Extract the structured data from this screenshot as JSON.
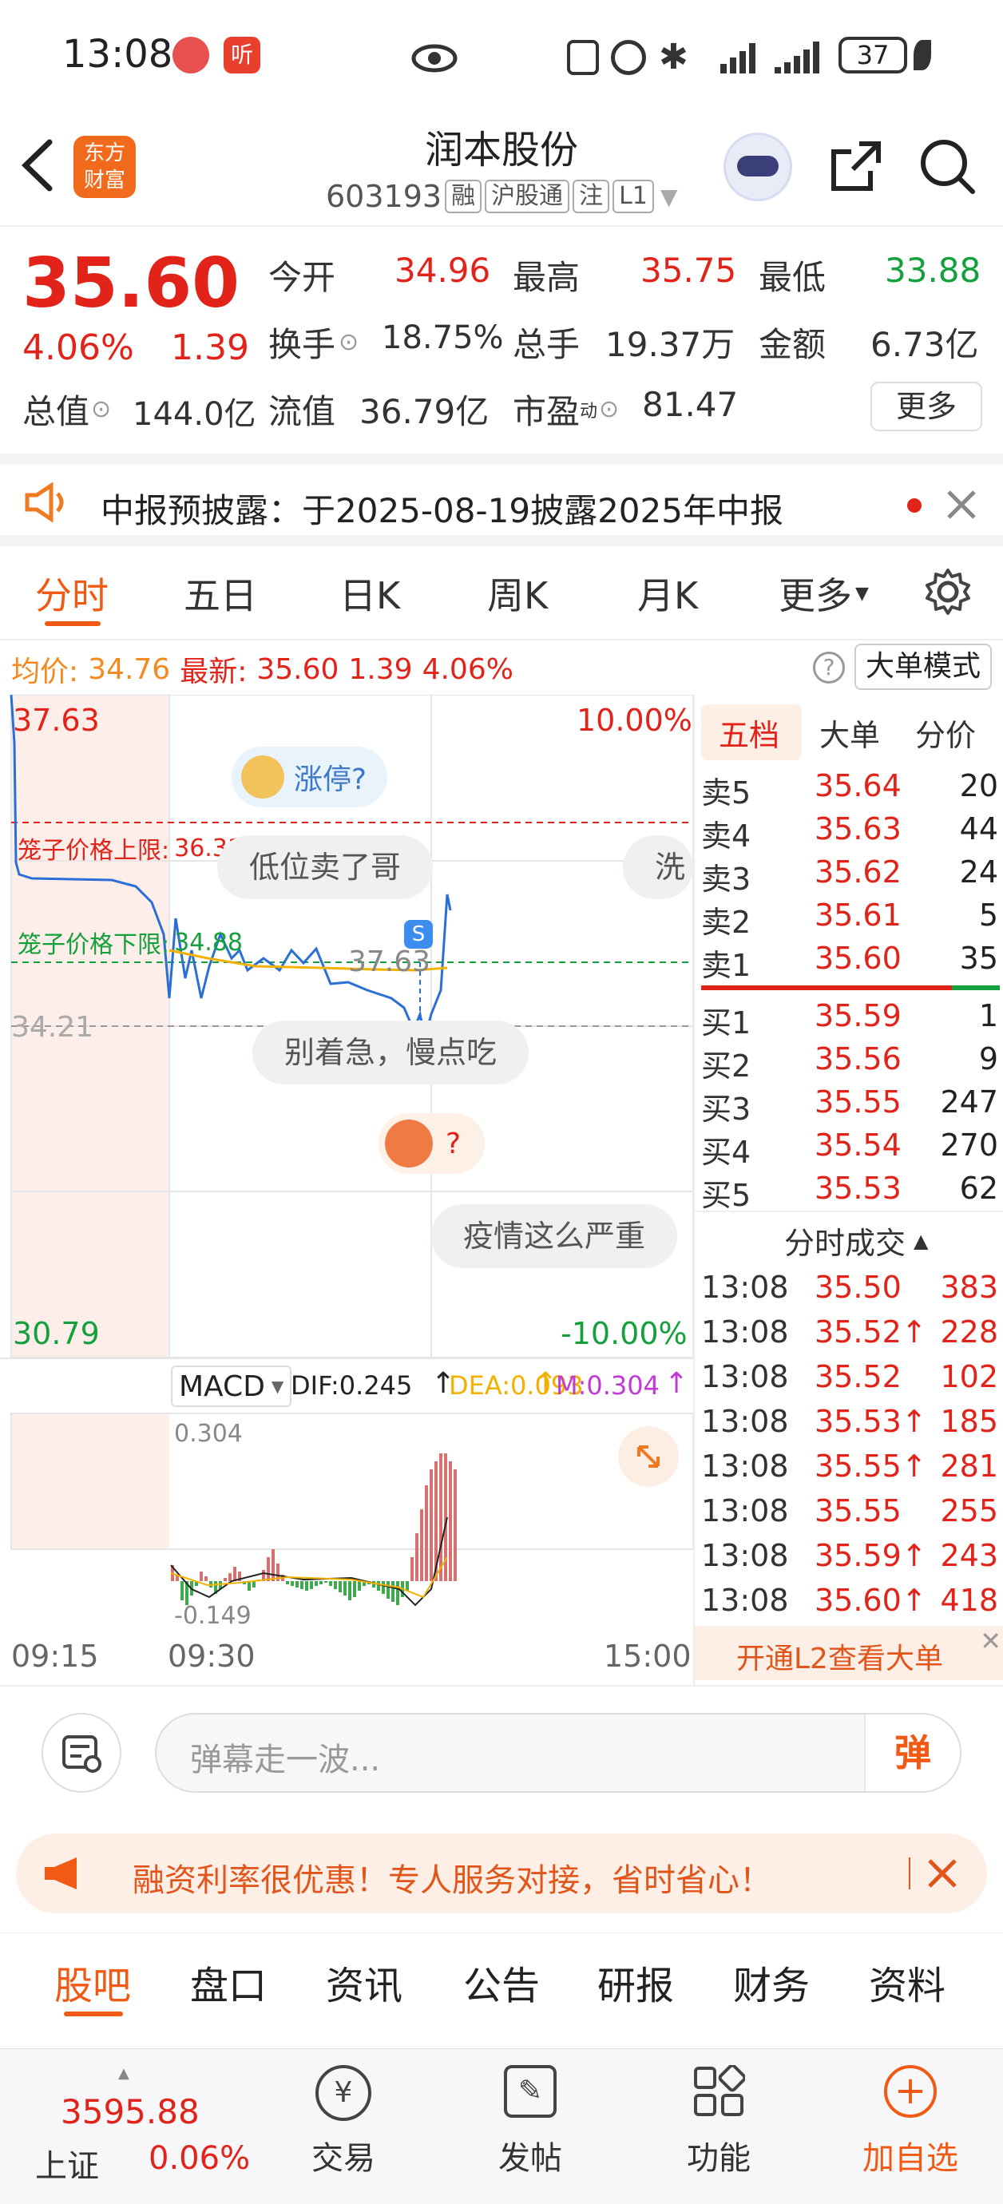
{
  "status_bar": {
    "time": "13:08",
    "battery": "37"
  },
  "header": {
    "title": "润本股份",
    "code": "603193",
    "tags": [
      "融",
      "沪股通",
      "注",
      "L1"
    ],
    "logo_text": [
      "东方",
      "财富"
    ]
  },
  "quote": {
    "price": "35.60",
    "change_pct": "4.06%",
    "change": "1.39",
    "open_label": "今开",
    "open": "34.96",
    "high_label": "最高",
    "high": "35.75",
    "low_label": "最低",
    "low": "33.88",
    "turnover_label": "换手",
    "turnover": "18.75%",
    "volume_label": "总手",
    "volume": "19.37万",
    "amount_label": "金额",
    "amount": "6.73亿",
    "mktcap_label": "总值",
    "mktcap": "144.0亿",
    "float_label": "流值",
    "float": "36.79亿",
    "pe_label": "市盈",
    "pe_sup": "动",
    "pe": "81.47",
    "more_label": "更多"
  },
  "notice": {
    "text": "中报预披露：于2025-08-19披露2025年中报"
  },
  "period_tabs": [
    "分时",
    "五日",
    "日K",
    "周K",
    "月K",
    "更多"
  ],
  "info_line": {
    "avg_label": "均价:",
    "avg": "34.76",
    "latest_label": "最新:",
    "latest": "35.60",
    "chg": "1.39",
    "pct": "4.06%",
    "mode_btn": "大单模式"
  },
  "intraday": {
    "y_top": "37.63",
    "y_top_pct": "10.00%",
    "y_mid": "34.21",
    "y_bot": "30.79",
    "y_bot_pct": "-10.00%",
    "upper_cage_label": "笼子价格上限:",
    "upper_cage": "36.31",
    "lower_cage_label": "笼子价格下限:",
    "lower_cage": "34.88",
    "cursor_value": "37.63",
    "time_labels": [
      "09:15",
      "09:30",
      "15:00"
    ],
    "danmaku": [
      "涨停?",
      "低位卖了哥",
      "洗",
      "别着急，慢点吃",
      "?",
      "疫情这么严重"
    ]
  },
  "macd": {
    "label": "MACD",
    "dif": "DIF:0.245",
    "dea": "DEA:0.093",
    "m": "M:0.304",
    "top": "0.304",
    "bottom": "-0.149"
  },
  "orderbook": {
    "tabs": [
      "五档",
      "大单",
      "分价"
    ],
    "asks": [
      {
        "label": "卖5",
        "price": "35.64",
        "vol": "20"
      },
      {
        "label": "卖4",
        "price": "35.63",
        "vol": "44"
      },
      {
        "label": "卖3",
        "price": "35.62",
        "vol": "24"
      },
      {
        "label": "卖2",
        "price": "35.61",
        "vol": "5"
      },
      {
        "label": "卖1",
        "price": "35.60",
        "vol": "35"
      }
    ],
    "bids": [
      {
        "label": "买1",
        "price": "35.59",
        "vol": "1"
      },
      {
        "label": "买2",
        "price": "35.56",
        "vol": "9"
      },
      {
        "label": "买3",
        "price": "35.55",
        "vol": "247"
      },
      {
        "label": "买4",
        "price": "35.54",
        "vol": "270"
      },
      {
        "label": "买5",
        "price": "35.53",
        "vol": "62"
      }
    ],
    "ticks_title": "分时成交",
    "ticks": [
      {
        "time": "13:08",
        "price": "35.50",
        "vol": "383",
        "arrow": ""
      },
      {
        "time": "13:08",
        "price": "35.52",
        "vol": "228",
        "arrow": "↑"
      },
      {
        "time": "13:08",
        "price": "35.52",
        "vol": "102",
        "arrow": ""
      },
      {
        "time": "13:08",
        "price": "35.53",
        "vol": "185",
        "arrow": "↑"
      },
      {
        "time": "13:08",
        "price": "35.55",
        "vol": "281",
        "arrow": "↑"
      },
      {
        "time": "13:08",
        "price": "35.55",
        "vol": "255",
        "arrow": ""
      },
      {
        "time": "13:08",
        "price": "35.59",
        "vol": "243",
        "arrow": "↑"
      },
      {
        "time": "13:08",
        "price": "35.60",
        "vol": "418",
        "arrow": "↑"
      }
    ],
    "l2_banner": "开通L2查看大单"
  },
  "danmaku_input": {
    "placeholder": "弹幕走一波...",
    "send": "弹"
  },
  "promo": {
    "text": "融资利率很优惠！专人服务对接，省时省心！"
  },
  "bottom_tabs": [
    "股吧",
    "盘口",
    "资讯",
    "公告",
    "研报",
    "财务",
    "资料"
  ],
  "bottom_nav": {
    "index_value": "3595.88",
    "index_name": "上证",
    "index_pct": "0.06%",
    "items": [
      "交易",
      "发帖",
      "功能",
      "加自选"
    ]
  }
}
